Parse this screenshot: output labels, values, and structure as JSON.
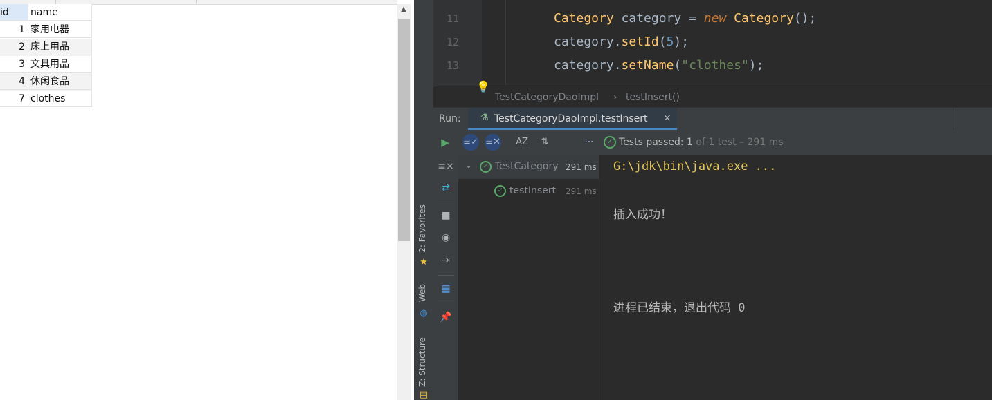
{
  "db_grid": {
    "columns": [
      "id",
      "name"
    ],
    "rows": [
      {
        "id": "1",
        "name": "家用电器"
      },
      {
        "id": "2",
        "name": "床上用品"
      },
      {
        "id": "3",
        "name": "文具用品"
      },
      {
        "id": "4",
        "name": "休闲食品"
      },
      {
        "id": "7",
        "name": "clothes"
      }
    ],
    "scroll_up_glyph": "▲"
  },
  "editor": {
    "lines": [
      {
        "number": "11"
      },
      {
        "number": "12"
      },
      {
        "number": "13"
      }
    ],
    "code_line_11": {
      "type": "Category",
      "var": " category = ",
      "kw": "new",
      "ctor": " Category",
      "tail": "();"
    },
    "code_line_12": {
      "obj": "category",
      "dot": ".",
      "method": "setId",
      "open": "(",
      "arg": "5",
      "close": ");"
    },
    "code_line_13": {
      "obj": "category",
      "dot": ".",
      "method": "setName",
      "open": "(",
      "arg": "\"clothes\"",
      "close": ");"
    }
  },
  "breadcrumb": {
    "class_name": "TestCategoryDaoImpl",
    "separator": "›",
    "method": "testInsert()"
  },
  "run_panel": {
    "label": "Run:",
    "tab_title": "TestCategoryDaoImpl.testInsert",
    "tab_close": "×",
    "status_prefix": "Tests passed: ",
    "status_count": "1",
    "status_suffix": " of 1 test – 291 ms"
  },
  "side_tabs": {
    "favorites": "2: Favorites",
    "web": "Web",
    "structure": "Z: Structure"
  },
  "test_tree": {
    "root": {
      "label": "TestCategory",
      "time": "291 ms"
    },
    "child": {
      "label": "testInsert",
      "time": "291 ms"
    }
  },
  "console": {
    "command": "G:\\jdk\\bin\\java.exe ...",
    "message": "插入成功！",
    "exit": "进程已结束，退出代码 0"
  },
  "colors": {
    "accent_blue": "#4a88c7",
    "pass_green": "#59a869",
    "command_yellow": "#e6c75a"
  }
}
